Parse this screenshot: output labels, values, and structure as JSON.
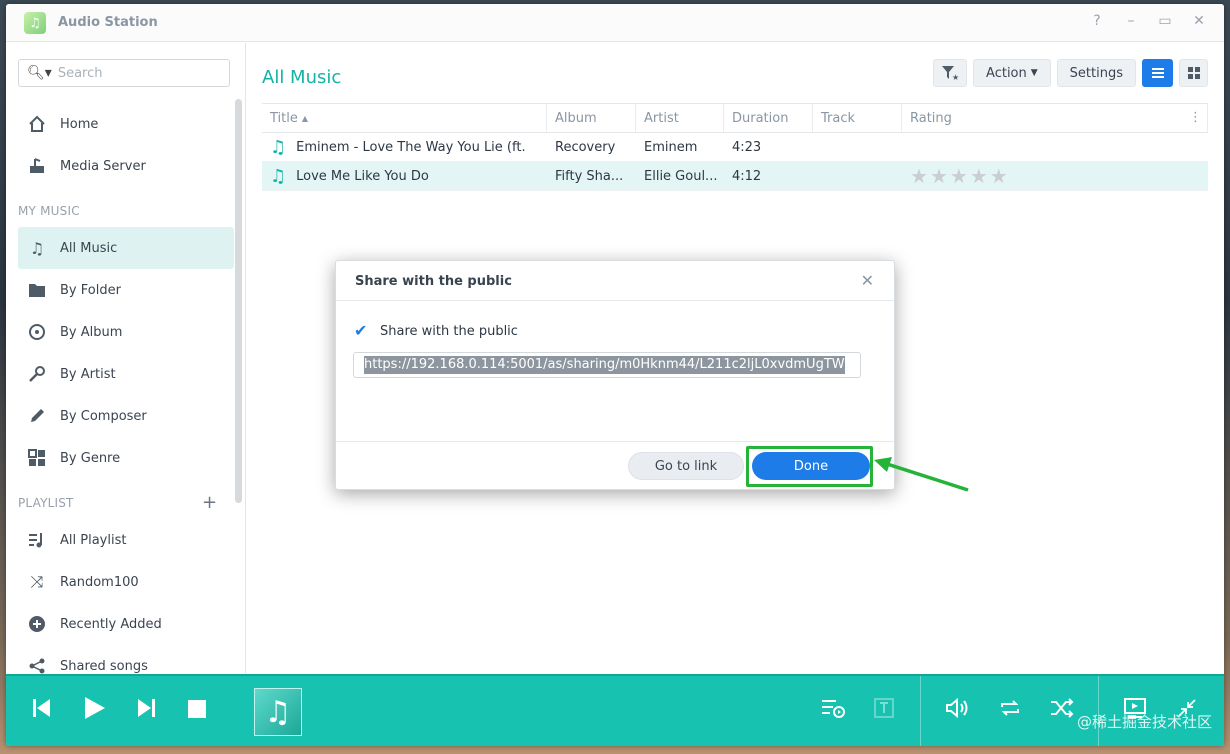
{
  "window": {
    "title": "Audio Station",
    "controls": [
      "?",
      "–",
      "▭",
      "✕"
    ]
  },
  "sidebar": {
    "search_placeholder": "Search",
    "items_top": [
      {
        "label": "Home",
        "icon": "home-icon"
      },
      {
        "label": "Media Server",
        "icon": "media-server-icon"
      }
    ],
    "my_music_label": "MY MUSIC",
    "my_music": [
      {
        "label": "All Music",
        "icon": "music-note-icon",
        "active": true
      },
      {
        "label": "By Folder",
        "icon": "folder-icon"
      },
      {
        "label": "By Album",
        "icon": "album-icon"
      },
      {
        "label": "By Artist",
        "icon": "microphone-icon"
      },
      {
        "label": "By Composer",
        "icon": "pen-icon"
      },
      {
        "label": "By Genre",
        "icon": "grid-icon"
      }
    ],
    "playlist_label": "PLAYLIST",
    "playlists": [
      {
        "label": "All Playlist",
        "icon": "playlist-icon"
      },
      {
        "label": "Random100",
        "icon": "shuffle-icon"
      },
      {
        "label": "Recently Added",
        "icon": "plus-circle-icon"
      },
      {
        "label": "Shared songs",
        "icon": "share-icon"
      }
    ]
  },
  "main": {
    "title": "All Music",
    "toolbar": {
      "action_label": "Action",
      "settings_label": "Settings"
    },
    "columns": [
      "Title",
      "Album",
      "Artist",
      "Duration",
      "Track",
      "Rating"
    ],
    "rows": [
      {
        "title": "Eminem - Love The Way You Lie (ft.",
        "album": "Recovery",
        "artist": "Eminem",
        "duration": "4:23",
        "track": "",
        "selected": false
      },
      {
        "title": "Love Me Like You Do",
        "album": "Fifty Sha...",
        "artist": "Ellie Goul...",
        "duration": "4:12",
        "track": "",
        "selected": true
      }
    ]
  },
  "dialog": {
    "title": "Share with the public",
    "checkbox_label": "Share with the public",
    "url": "https://192.168.0.114:5001/as/sharing/m0Hknm44/L211c2ljL0xvdmUgTW",
    "go_to_link_label": "Go to link",
    "done_label": "Done"
  },
  "watermark": "@稀土掘金技术社区",
  "colors": {
    "accent": "#14b3a6",
    "primary": "#1e7ce8",
    "player_bg": "#17c2b0",
    "highlight": "#25b33a"
  }
}
